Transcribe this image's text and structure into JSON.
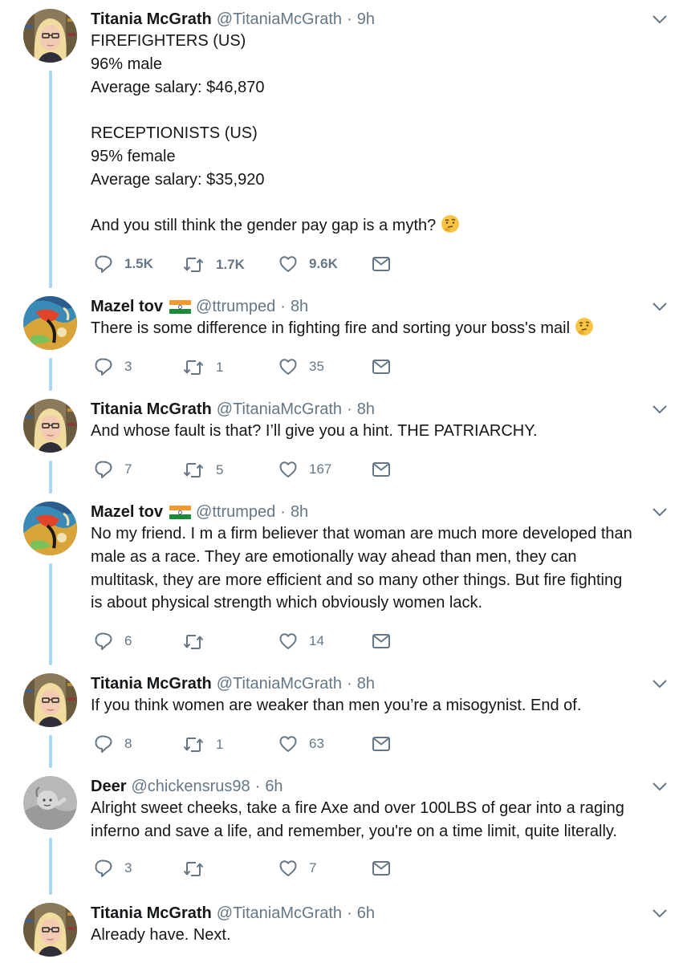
{
  "thread": [
    {
      "name": "Titania McGrath",
      "handle": "@TitaniaMcGrath",
      "time": "9h",
      "flag": false,
      "avatar": "woman-glasses",
      "lines": [
        "FIREFIGHTERS (US)",
        "96% male",
        "Average salary: $46,870",
        "",
        "RECEPTIONISTS (US)",
        "95% female",
        "Average salary: $35,920",
        "",
        "And you still think the gender pay gap is a myth?"
      ],
      "emoji": "thinking-face",
      "replies": "1.5K",
      "retweets": "1.7K",
      "likes": "9.6K"
    },
    {
      "name": "Mazel tov",
      "handle": "@ttrumped",
      "time": "8h",
      "flag": true,
      "avatar": "colorful-art",
      "lines": [
        "There is some difference in fighting fire and sorting your boss's mail"
      ],
      "emoji": "thinking-face",
      "replies": "3",
      "retweets": "1",
      "likes": "35"
    },
    {
      "name": "Titania McGrath",
      "handle": "@TitaniaMcGrath",
      "time": "8h",
      "flag": false,
      "avatar": "woman-glasses",
      "lines": [
        "And whose fault is that? I’ll give you a hint. THE PATRIARCHY."
      ],
      "replies": "7",
      "retweets": "5",
      "likes": "167"
    },
    {
      "name": "Mazel tov",
      "handle": "@ttrumped",
      "time": "8h",
      "flag": true,
      "avatar": "colorful-art",
      "lines": [
        "No my friend. I m a firm believer that woman are much more developed than",
        "male as a race. They are emotionally way ahead than men, they can",
        "multitask, they are more efficient and so many other things. But fire fighting",
        "is about physical strength which obviously women lack."
      ],
      "replies": "6",
      "retweets": "",
      "likes": "14"
    },
    {
      "name": "Titania McGrath",
      "handle": "@TitaniaMcGrath",
      "time": "8h",
      "flag": false,
      "avatar": "woman-glasses",
      "lines": [
        "If you think women are weaker than men you’re a misogynist. End of."
      ],
      "replies": "8",
      "retweets": "1",
      "likes": "63"
    },
    {
      "name": "Deer",
      "handle": "@chickensrus98",
      "time": "6h",
      "flag": false,
      "avatar": "grey-figure",
      "lines": [
        "Alright sweet cheeks, take a fire Axe and over 100LBS of gear into a raging",
        "inferno and save a life, and remember, you're on a time limit, quite literally."
      ],
      "replies": "3",
      "retweets": "",
      "likes": "7"
    },
    {
      "name": "Titania McGrath",
      "handle": "@TitaniaMcGrath",
      "time": "6h",
      "flag": false,
      "avatar": "woman-glasses",
      "lines": [
        "Already have. Next."
      ]
    }
  ],
  "colors": {
    "thread_line": "#a8d6f5",
    "grey_text": "#657786",
    "icon": "#657786"
  },
  "icons": {
    "reply": "reply-icon",
    "retweet": "retweet-icon",
    "like": "heart-icon",
    "dm": "envelope-icon",
    "caret": "chevron-down-icon"
  }
}
